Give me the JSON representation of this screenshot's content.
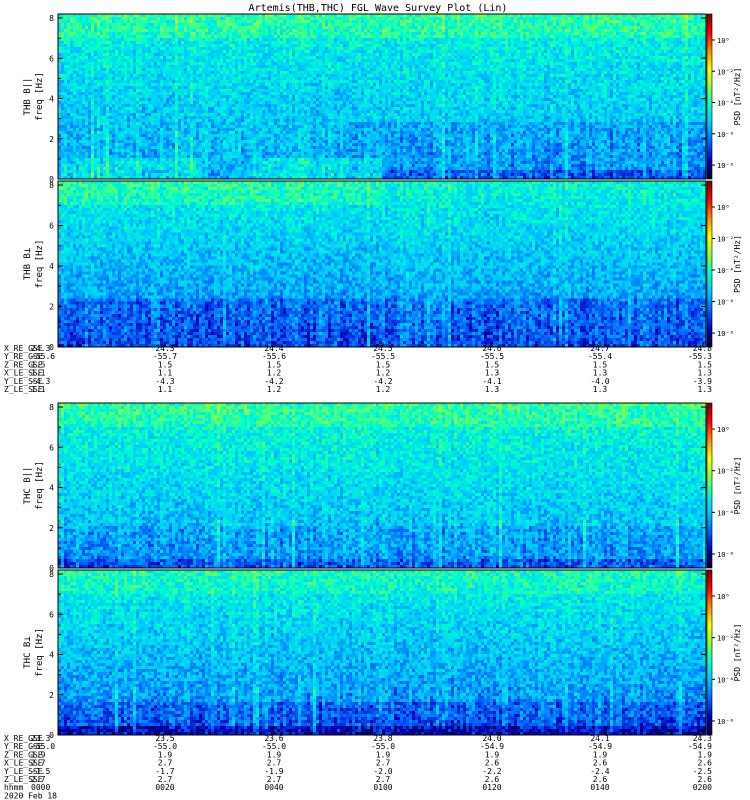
{
  "title": "Artemis(THB,THC) FGL Wave Survey Plot (Lin)",
  "colors": {
    "colorbar_stops": [
      "#7a0000",
      "#ff0000",
      "#ff8800",
      "#ffff00",
      "#88ff44",
      "#00ffcc",
      "#00c8ff",
      "#0066ff",
      "#0000b8",
      "#000033"
    ]
  },
  "chart_data": [
    {
      "type": "heatmap",
      "id": "thb_bll",
      "ylabel_probe": "THB B||",
      "ylabel_freq": "freq [Hz]",
      "yticks": [
        "0",
        "2",
        "4",
        "6",
        "8"
      ],
      "ylim": [
        0,
        8.2
      ],
      "cbar_label": "PSD [nT²/Hz]",
      "cbar_ticks": [
        "10⁻⁸",
        "10⁻⁶",
        "10⁻⁴",
        "10⁻²",
        "10⁰"
      ],
      "profile": "bll_b",
      "seed": 11
    },
    {
      "type": "heatmap",
      "id": "thb_bperp",
      "ylabel_probe": "THB B⊥",
      "ylabel_freq": "freq [Hz]",
      "yticks": [
        "0",
        "2",
        "4",
        "6",
        "8"
      ],
      "ylim": [
        0,
        8.2
      ],
      "cbar_label": "PSD [nT²/Hz]",
      "cbar_ticks": [
        "10⁻⁸",
        "10⁻⁶",
        "10⁻⁴",
        "10⁻²",
        "10⁰"
      ],
      "profile": "bperp_b",
      "seed": 23
    },
    {
      "type": "heatmap",
      "id": "thc_bll",
      "ylabel_probe": "THC B||",
      "ylabel_freq": "freq [Hz]",
      "yticks": [
        "0",
        "2",
        "4",
        "6",
        "8"
      ],
      "ylim": [
        0,
        8.2
      ],
      "cbar_label": "PSD [nT²/Hz]",
      "cbar_ticks": [
        "10⁻⁶",
        "10⁻⁴",
        "10⁻²",
        "10⁰"
      ],
      "profile": "bll_c",
      "seed": 37
    },
    {
      "type": "heatmap",
      "id": "thc_bperp",
      "ylabel_probe": "THC B⊥",
      "ylabel_freq": "freq [Hz]",
      "yticks": [
        "0",
        "2",
        "4",
        "6",
        "8"
      ],
      "ylim": [
        0,
        8.2
      ],
      "cbar_label": "PSD [nT²/Hz]",
      "cbar_ticks": [
        "10⁻⁶",
        "10⁻⁴",
        "10⁻²",
        "10⁰"
      ],
      "profile": "bperp_c",
      "seed": 51
    }
  ],
  "ephemeris_blocks": [
    {
      "rows": [
        {
          "label": "X_RE_GSE",
          "values": [
            "24.3",
            "24.3",
            "24.4",
            "24.5",
            "24.6",
            "24.7",
            "24.8"
          ]
        },
        {
          "label": "Y_RE_GSE",
          "values": [
            "-55.6",
            "-55.7",
            "-55.6",
            "-55.5",
            "-55.5",
            "-55.4",
            "-55.3"
          ]
        },
        {
          "label": "Z_RE_GSE",
          "values": [
            "1.5",
            "1.5",
            "1.5",
            "1.5",
            "1.5",
            "1.5",
            "1.5"
          ]
        },
        {
          "label": "X_LE_SSE",
          "values": [
            "1.1",
            "1.1",
            "1.2",
            "1.2",
            "1.3",
            "1.3",
            "1.3"
          ]
        },
        {
          "label": "Y_LE_SSE",
          "values": [
            "-4.3",
            "-4.3",
            "-4.2",
            "-4.2",
            "-4.1",
            "-4.0",
            "-3.9"
          ]
        },
        {
          "label": "Z_LE_SSE",
          "values": [
            "1.1",
            "1.1",
            "1.2",
            "1.2",
            "1.3",
            "1.3",
            "1.3"
          ]
        }
      ]
    },
    {
      "rows": [
        {
          "label": "X_RE_GSE",
          "values": [
            "23.3",
            "23.5",
            "23.6",
            "23.8",
            "24.0",
            "24.1",
            "24.3"
          ]
        },
        {
          "label": "Y_RE_GSE",
          "values": [
            "-55.0",
            "-55.0",
            "-55.0",
            "-55.0",
            "-54.9",
            "-54.9",
            "-54.9"
          ]
        },
        {
          "label": "Z_RE_GSE",
          "values": [
            "1.9",
            "1.9",
            "1.9",
            "1.9",
            "1.9",
            "1.9",
            "1.9"
          ]
        },
        {
          "label": "X_LE_SSE",
          "values": [
            "2.7",
            "2.7",
            "2.7",
            "2.7",
            "2.6",
            "2.6",
            "2.6"
          ]
        },
        {
          "label": "Y_LE_SSE",
          "values": [
            "-1.5",
            "-1.7",
            "-1.9",
            "-2.0",
            "-2.2",
            "-2.4",
            "-2.5"
          ]
        },
        {
          "label": "Z_LE_SSE",
          "values": [
            "2.7",
            "2.7",
            "2.7",
            "2.7",
            "2.6",
            "2.6",
            "2.6"
          ]
        },
        {
          "label": "hhmm",
          "values": [
            "0000",
            "0020",
            "0040",
            "0100",
            "0120",
            "0140",
            "0200"
          ]
        },
        {
          "label": "2020 Feb 18",
          "values": []
        }
      ]
    }
  ]
}
